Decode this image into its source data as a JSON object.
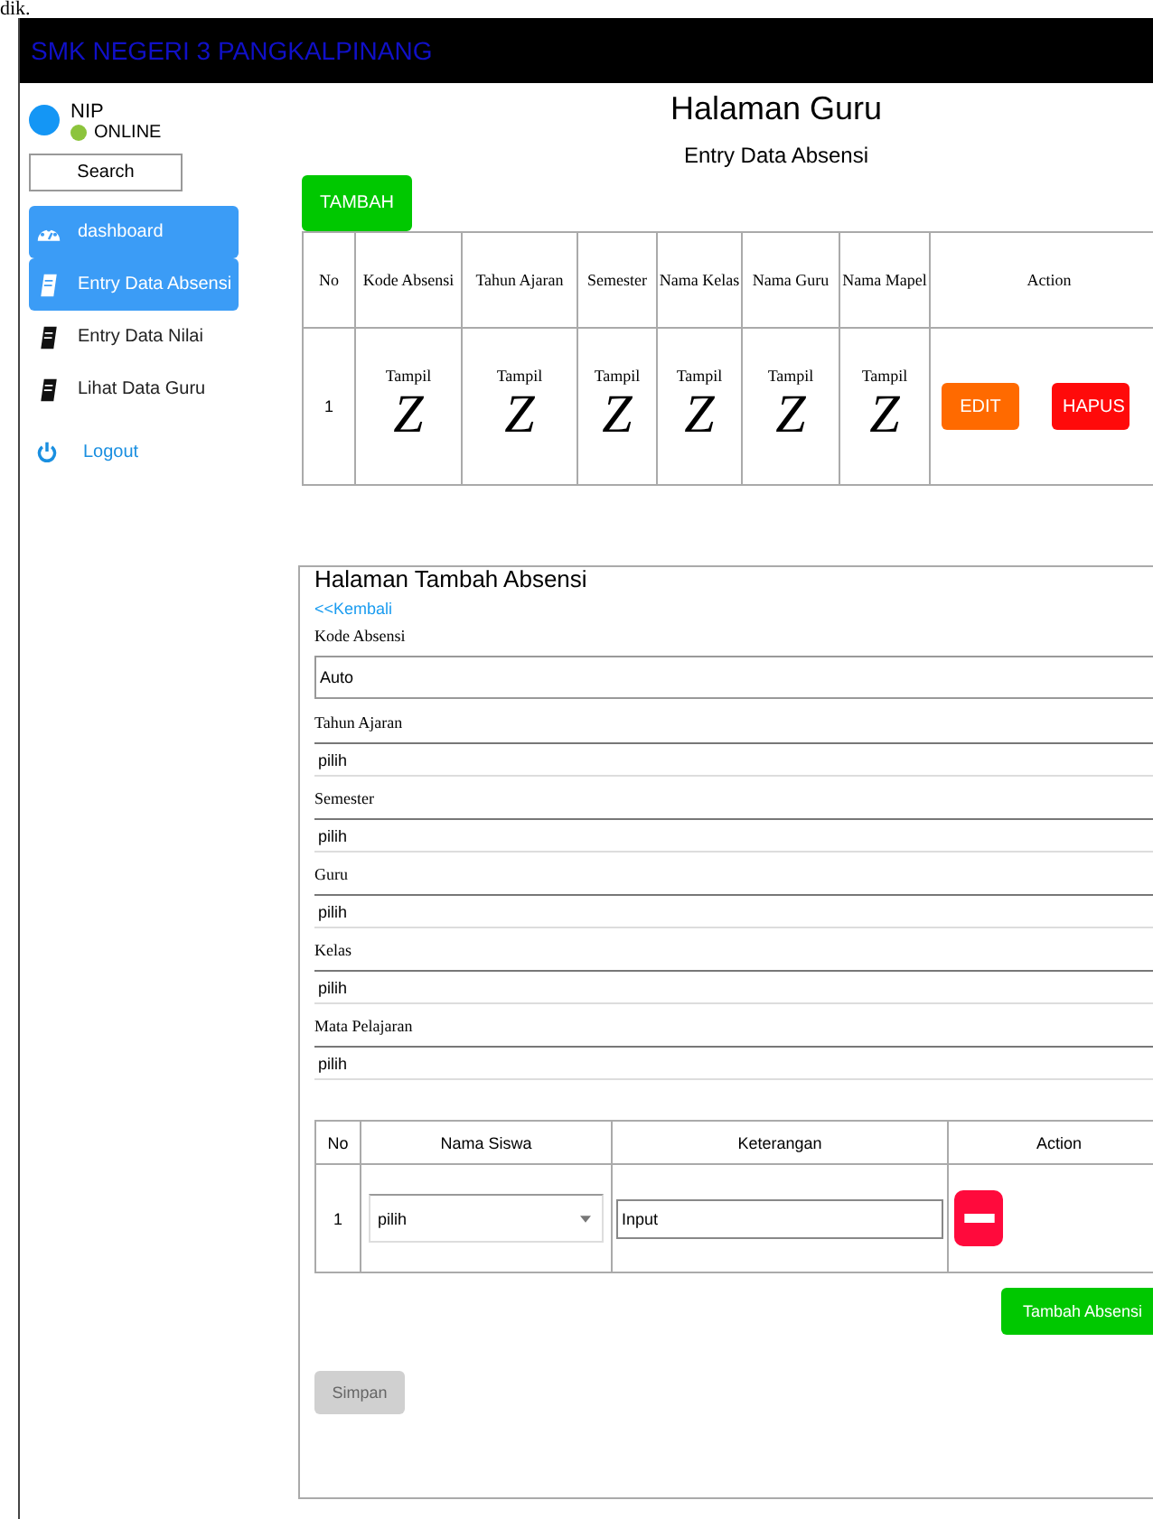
{
  "top_fragment": "dik.",
  "header": {
    "title": "SMK NEGERI 3 PANGKALPINANG"
  },
  "user": {
    "name": "NIP",
    "status": "ONLINE",
    "online": true
  },
  "search": {
    "label": "Search"
  },
  "sidebar": {
    "items": [
      {
        "label": "dashboard",
        "kind": "dashboard",
        "selected": true
      },
      {
        "label": "Entry Data Absensi",
        "kind": "book",
        "selected": true
      },
      {
        "label": "Entry Data Nilai",
        "kind": "book",
        "selected": false
      },
      {
        "label": "Lihat Data Guru",
        "kind": "book",
        "selected": false
      }
    ],
    "logout": {
      "label": "Logout"
    }
  },
  "page": {
    "title": "Halaman Guru",
    "subtitle": "Entry Data Absensi"
  },
  "add_button": "TAMBAH",
  "table": {
    "columns": [
      "No",
      "Kode Absensi",
      "Tahun Ajaran",
      "Semester",
      "Nama Kelas",
      "Nama Guru",
      "Nama Mapel",
      "Action"
    ],
    "rows": [
      {
        "cells": [
          {
            "kind": "text",
            "text": "1"
          },
          {
            "kind": "show",
            "label": "Tampil",
            "glyph": "Z"
          },
          {
            "kind": "show",
            "label": "Tampil",
            "glyph": "Z"
          },
          {
            "kind": "show",
            "label": "Tampil",
            "glyph": "Z"
          },
          {
            "kind": "show",
            "label": "Tampil",
            "glyph": "Z"
          },
          {
            "kind": "show",
            "label": "Tampil",
            "glyph": "Z"
          },
          {
            "kind": "show",
            "label": "Tampil",
            "glyph": "Z"
          },
          {
            "kind": "actions",
            "buttons": [
              {
                "label": "EDIT",
                "kind": "edit"
              },
              {
                "label": "HAPUS",
                "kind": "delete"
              }
            ]
          }
        ]
      }
    ]
  },
  "form": {
    "title": "Halaman Tambah Absensi",
    "back_link": "<<Kembali",
    "fields": [
      {
        "label": "Kode Absensi",
        "kind": "text",
        "value": "Auto"
      },
      {
        "label": "Tahun Ajaran",
        "kind": "select",
        "value": "pilih"
      },
      {
        "label": "Semester",
        "kind": "select",
        "value": "pilih"
      },
      {
        "label": "Guru",
        "kind": "select",
        "value": "pilih"
      },
      {
        "label": "Kelas",
        "kind": "select",
        "value": "pilih"
      },
      {
        "label": "Mata Pelajaran",
        "kind": "select",
        "value": "pilih"
      }
    ],
    "students": {
      "columns": [
        "No",
        "Nama Siswa",
        "Keterangan",
        "Action"
      ],
      "rows": [
        {
          "cells": [
            {
              "kind": "text",
              "text": "1"
            },
            {
              "kind": "select",
              "value": "pilih"
            },
            {
              "kind": "input",
              "value": "Input"
            },
            {
              "kind": "remove"
            }
          ]
        }
      ]
    },
    "add_row_button": "Tambah Absensi",
    "save_button": {
      "label": "Simpan",
      "disabled": true
    }
  }
}
